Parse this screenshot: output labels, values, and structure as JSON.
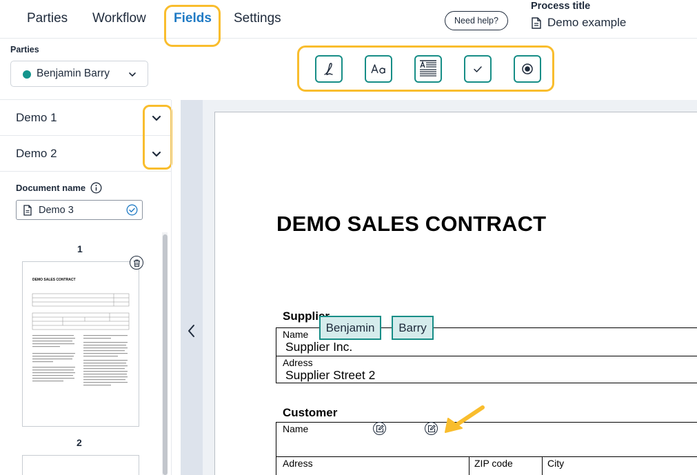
{
  "nav": {
    "tabs": [
      {
        "label": "Parties"
      },
      {
        "label": "Workflow"
      },
      {
        "label": "Fields"
      },
      {
        "label": "Settings"
      }
    ],
    "active_tab": "Fields",
    "help_label": "Need help?",
    "process_title_label": "Process title",
    "process_title_value": "Demo example"
  },
  "parties": {
    "label": "Parties",
    "selected": "Benjamin Barry",
    "dot_color": "#14958d"
  },
  "toolbar": {
    "tools": [
      {
        "icon": "signature-icon"
      },
      {
        "icon": "text-field-icon"
      },
      {
        "icon": "text-block-icon"
      },
      {
        "icon": "checkbox-icon"
      },
      {
        "icon": "radio-button-icon"
      }
    ],
    "accent": "#168d86",
    "highlight": "#f9bd2d"
  },
  "sidebar": {
    "documents": [
      {
        "name": "Demo 1"
      },
      {
        "name": "Demo 2"
      }
    ],
    "document_name_label": "Document name",
    "document_name_value": "Demo 3",
    "pages": [
      {
        "number": "1"
      },
      {
        "number": "2"
      }
    ],
    "thumb_title": "DEMO SALES CONTRACT"
  },
  "document": {
    "title": "DEMO SALES CONTRACT",
    "supplier": {
      "heading": "Supplier",
      "name_label": "Name",
      "name_value": "Supplier Inc.",
      "address_label": "Adress",
      "address_value": "Supplier Street 2"
    },
    "customer": {
      "heading": "Customer",
      "name_label": "Name",
      "fields": [
        {
          "value": "Benjamin"
        },
        {
          "value": "Barry"
        }
      ],
      "address_label": "Adress",
      "zip_label": "ZIP code",
      "city_label": "City"
    }
  }
}
